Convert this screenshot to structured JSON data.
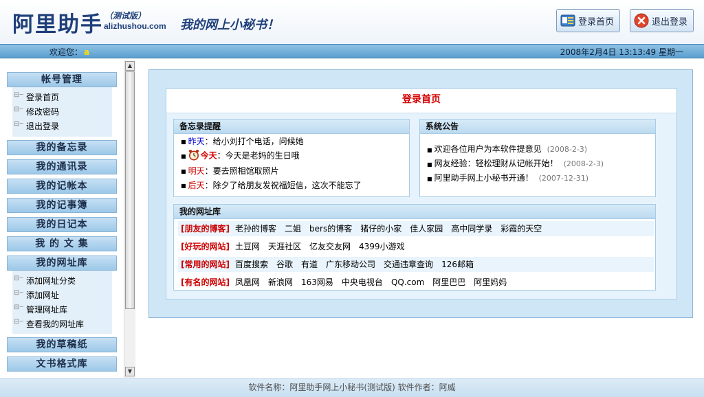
{
  "header": {
    "logo": "阿里助手",
    "edition": "（测试版）",
    "domain": "alizhushou.com",
    "slogan": "我的网上小秘书！",
    "btn_home": "登录首页",
    "btn_logout": "退出登录"
  },
  "topbar": {
    "welcome": "欢迎您：",
    "username": "a",
    "datetime": "2008年2月4日 13:13:49 星期一"
  },
  "sidebar": {
    "account": {
      "title": "帐号管理",
      "items": [
        "登录首页",
        "修改密码",
        "退出登录"
      ]
    },
    "menu1": [
      "我的备忘录",
      "我的通讯录",
      "我的记帐本",
      "我的记事簿",
      "我的日记本",
      "我 的 文 集",
      "我的网址库"
    ],
    "links_items": [
      "添加网址分类",
      "添加网址",
      "管理网址库",
      "查看我的网址库"
    ],
    "menu2": [
      "我的草稿纸",
      "文书格式库"
    ]
  },
  "content": {
    "title": "登录首页",
    "memo": {
      "title": "备忘录提醒",
      "rows": [
        {
          "label": "昨天",
          "text": "：给小刘打个电话，问候她"
        },
        {
          "label": "今天",
          "text": "：今天是老妈的生日哦"
        },
        {
          "label": "明天",
          "text": "：要去照相馆取照片"
        },
        {
          "label": "后天",
          "text": "：除夕了给朋友发祝福短信，这次不能忘了"
        }
      ]
    },
    "notice": {
      "title": "系统公告",
      "rows": [
        {
          "text": "欢迎各位用户为本软件提意见",
          "date": "(2008-2-3)"
        },
        {
          "text": "网友经验：轻松理财从记帐开始！",
          "date": "(2008-2-3)"
        },
        {
          "text": "阿里助手网上小秘书开通！",
          "date": "(2007-12-31)"
        }
      ]
    },
    "links": {
      "title": "我的网址库",
      "rows": [
        {
          "category": "[朋友的博客]",
          "sites": [
            "老孙的博客",
            "二姐",
            "bers的博客",
            "猪仔的小家",
            "佳人家园",
            "高中同学录",
            "彩霞的天空"
          ]
        },
        {
          "category": "[好玩的网站]",
          "sites": [
            "土豆网",
            "天涯社区",
            "亿友交友网",
            "4399小游戏"
          ]
        },
        {
          "category": "[常用的网站]",
          "sites": [
            "百度搜索",
            "谷歌",
            "有道",
            "广东移动公司",
            "交通违章查询",
            "126邮箱"
          ]
        },
        {
          "category": "[有名的网站]",
          "sites": [
            "凤凰网",
            "新浪网",
            "163网易",
            "中央电视台",
            "QQ.com",
            "阿里巴巴",
            "阿里妈妈"
          ]
        }
      ]
    }
  },
  "footer": {
    "text": "软件名称：阿里助手网上小秘书(测试版)    软件作者：阿威"
  },
  "icons": {
    "home": "home-page-icon",
    "logout": "logout-x-icon",
    "alarm": "alarm-clock-icon"
  },
  "colors": {
    "accent": "#5b9fd0",
    "title_red": "#d40000",
    "link_blue": "#0000cc"
  }
}
